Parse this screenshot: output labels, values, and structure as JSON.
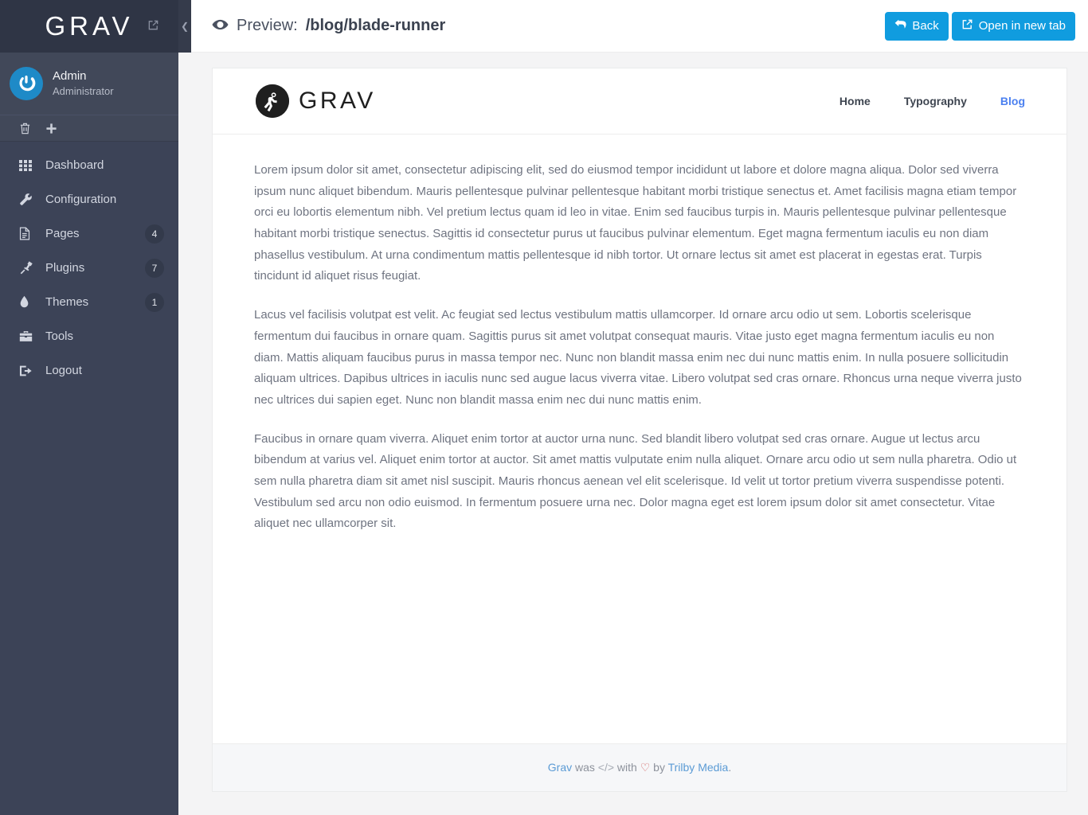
{
  "sidebar": {
    "logo_text": "GRAV",
    "logo_external_icon": "external-link-icon",
    "collapse_icon": "chevron-left-icon",
    "user": {
      "name": "Admin",
      "role": "Administrator",
      "avatar_icon": "gravatar-logo"
    },
    "quick_actions": [
      {
        "icon": "trash-icon",
        "name": "clear-cache"
      },
      {
        "icon": "plus-icon",
        "name": "add-page"
      }
    ],
    "items": [
      {
        "label": "Dashboard",
        "icon": "grid-icon",
        "badge": ""
      },
      {
        "label": "Configuration",
        "icon": "wrench-icon",
        "badge": ""
      },
      {
        "label": "Pages",
        "icon": "file-icon",
        "badge": "4"
      },
      {
        "label": "Plugins",
        "icon": "plug-icon",
        "badge": "7"
      },
      {
        "label": "Themes",
        "icon": "droplet-icon",
        "badge": "1"
      },
      {
        "label": "Tools",
        "icon": "toolbox-icon",
        "badge": ""
      },
      {
        "label": "Logout",
        "icon": "logout-icon",
        "badge": ""
      }
    ]
  },
  "topbar": {
    "eye_icon": "eye-icon",
    "preview_label": "Preview:",
    "preview_path": "/blog/blade-runner",
    "back_label": "Back",
    "back_icon": "arrow-back-icon",
    "open_label": "Open in new tab",
    "open_icon": "external-link-icon"
  },
  "preview": {
    "site": {
      "logo_text": "GRAV",
      "logo_icon": "astronaut-logo",
      "nav": [
        {
          "label": "Home",
          "active": false
        },
        {
          "label": "Typography",
          "active": false
        },
        {
          "label": "Blog",
          "active": true
        }
      ],
      "paragraphs": [
        "Lorem ipsum dolor sit amet, consectetur adipiscing elit, sed do eiusmod tempor incididunt ut labore et dolore magna aliqua. Dolor sed viverra ipsum nunc aliquet bibendum. Mauris pellentesque pulvinar pellentesque habitant morbi tristique senectus et. Amet facilisis magna etiam tempor orci eu lobortis elementum nibh. Vel pretium lectus quam id leo in vitae. Enim sed faucibus turpis in. Mauris pellentesque pulvinar pellentesque habitant morbi tristique senectus. Sagittis id consectetur purus ut faucibus pulvinar elementum. Eget magna fermentum iaculis eu non diam phasellus vestibulum. At urna condimentum mattis pellentesque id nibh tortor. Ut ornare lectus sit amet est placerat in egestas erat. Turpis tincidunt id aliquet risus feugiat.",
        "Lacus vel facilisis volutpat est velit. Ac feugiat sed lectus vestibulum mattis ullamcorper. Id ornare arcu odio ut sem. Lobortis scelerisque fermentum dui faucibus in ornare quam. Sagittis purus sit amet volutpat consequat mauris. Vitae justo eget magna fermentum iaculis eu non diam. Mattis aliquam faucibus purus in massa tempor nec. Nunc non blandit massa enim nec dui nunc mattis enim. In nulla posuere sollicitudin aliquam ultrices. Dapibus ultrices in iaculis nunc sed augue lacus viverra vitae. Libero volutpat sed cras ornare. Rhoncus urna neque viverra justo nec ultrices dui sapien eget. Nunc non blandit massa enim nec dui nunc mattis enim.",
        "Faucibus in ornare quam viverra. Aliquet enim tortor at auctor urna nunc. Sed blandit libero volutpat sed cras ornare. Augue ut lectus arcu bibendum at varius vel. Aliquet enim tortor at auctor. Sit amet mattis vulputate enim nulla aliquet. Ornare arcu odio ut sem nulla pharetra. Odio ut sem nulla pharetra diam sit amet nisl suscipit. Mauris rhoncus aenean vel elit scelerisque. Id velit ut tortor pretium viverra suspendisse potenti. Vestibulum sed arcu non odio euismod. In fermentum posuere urna nec. Dolor magna eget est lorem ipsum dolor sit amet consectetur. Vitae aliquet nec ullamcorper sit."
      ],
      "footer": {
        "brand": "Grav",
        "was": " was ",
        "code": "</>",
        "with": " with ",
        "heart": "♡",
        "by": " by ",
        "author": "Trilby Media",
        "period": "."
      }
    }
  },
  "colors": {
    "accent_blue": "#109cdf",
    "sidebar_bg": "#3c4357",
    "link_blue": "#4b80f0"
  }
}
